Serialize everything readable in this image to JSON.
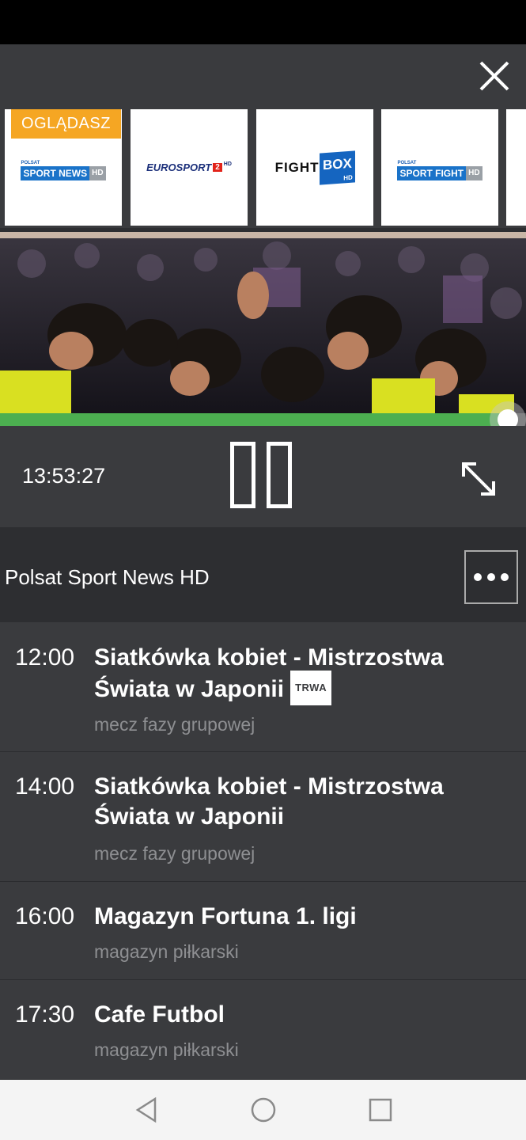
{
  "top_bar": {
    "close_icon": "close-icon"
  },
  "channels": {
    "watching_label": "OGLĄDASZ",
    "items": [
      {
        "top": "POLSAT",
        "main": "SPORT NEWS",
        "suffix": "HD"
      },
      {
        "main": "EUROSPORT",
        "num": "2",
        "suffix": "HD"
      },
      {
        "main": "FIGHT",
        "box": "BOX",
        "suffix": "HD"
      },
      {
        "top": "POLSAT",
        "main": "SPORT FIGHT",
        "suffix": "HD"
      }
    ]
  },
  "player": {
    "progress": 0.965,
    "time": "13:53:27",
    "colors": {
      "progress": "#4caf50",
      "badge": "#f5a623"
    }
  },
  "channel": {
    "name": "Polsat Sport News HD"
  },
  "schedule": [
    {
      "time": "12:00",
      "title": "Siatkówka kobiet - Mistrzostwa Świata w Japonii",
      "badge": "TRWA",
      "subtitle": "mecz fazy grupowej"
    },
    {
      "time": "14:00",
      "title": "Siatkówka kobiet - Mistrzostwa Świata w Japonii",
      "subtitle": "mecz fazy grupowej"
    },
    {
      "time": "16:00",
      "title": "Magazyn Fortuna 1. ligi",
      "subtitle": "magazyn piłkarski"
    },
    {
      "time": "17:30",
      "title": "Cafe Futbol",
      "subtitle": "magazyn piłkarski"
    }
  ]
}
